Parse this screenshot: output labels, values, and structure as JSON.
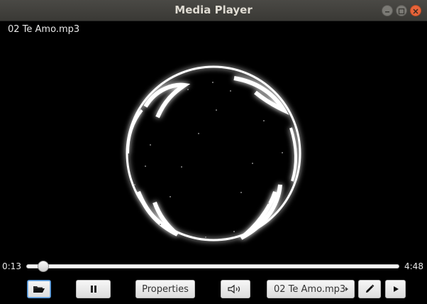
{
  "window": {
    "title": "Media Player"
  },
  "player": {
    "now_playing": "02 Te Amo.mp3",
    "elapsed": "0:13",
    "duration": "4:48",
    "progress_fraction": 0.045
  },
  "toolbar": {
    "open_icon": "folder-open-icon",
    "pause_icon": "pause-icon",
    "properties_label": "Properties",
    "volume_icon": "speaker-icon",
    "playlist_selected": "02 Te Amo.mp3",
    "edit_icon": "pencil-icon",
    "next_icon": "play-next-icon"
  }
}
